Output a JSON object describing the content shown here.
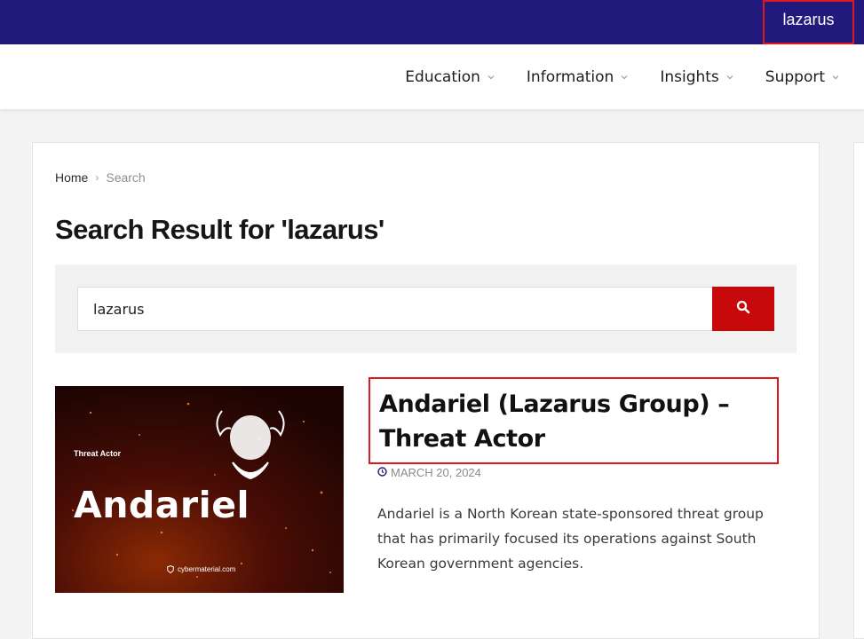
{
  "topbar": {
    "search_term": "lazarus"
  },
  "nav": {
    "items": [
      {
        "label": "Education"
      },
      {
        "label": "Information"
      },
      {
        "label": "Insights"
      },
      {
        "label": "Support"
      }
    ]
  },
  "breadcrumb": {
    "home": "Home",
    "separator": "›",
    "current": "Search"
  },
  "page": {
    "title": "Search Result for 'lazarus'"
  },
  "search": {
    "value": "lazarus",
    "button_icon": "search-icon"
  },
  "result": {
    "thumbnail": {
      "label": "Threat Actor",
      "name": "Andariel",
      "brand": "cybermaterial.com"
    },
    "title": "Andariel (Lazarus Group) – Threat Actor",
    "date": "MARCH 20, 2024",
    "excerpt": "Andariel is a North Korean state-sponsored threat group that has primarily focused its operations against South Korean government agencies."
  },
  "colors": {
    "topbar": "#1f1a7b",
    "accent_red": "#c8090c",
    "highlight_border": "#e0181e"
  }
}
